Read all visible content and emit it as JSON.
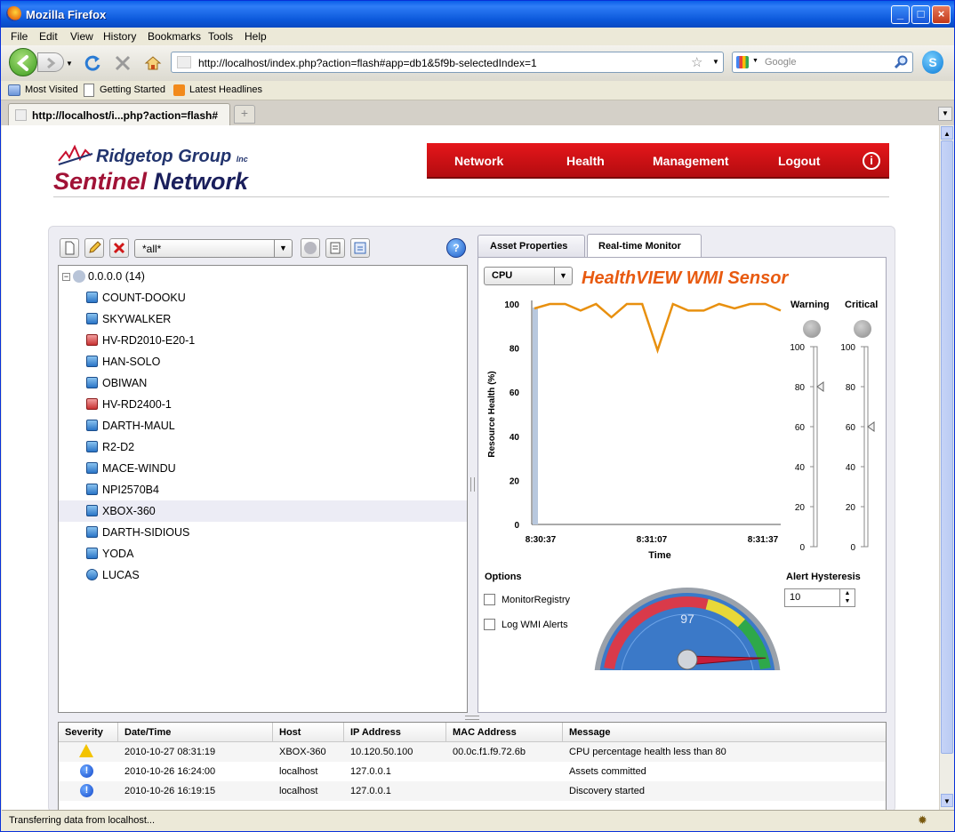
{
  "browser": {
    "title": "Mozilla Firefox",
    "menu": [
      "File",
      "Edit",
      "View",
      "History",
      "Bookmarks",
      "Tools",
      "Help"
    ],
    "url": "http://localhost/index.php?action=flash#app=db1&5f9b-selectedIndex=1",
    "search_placeholder": "Google",
    "bookmarks": [
      "Most Visited",
      "Getting Started",
      "Latest Headlines"
    ],
    "tab_label": "http://localhost/i...php?action=flash#",
    "new_tab_glyph": "+",
    "status": "Transferring data from localhost..."
  },
  "app": {
    "logo_top": "Ridgetop Group",
    "logo_inc": "Inc",
    "logo_sentinel": "Sentinel",
    "logo_network": "Network",
    "nav": [
      "Network",
      "Health",
      "Management",
      "Logout"
    ],
    "info_glyph": "i",
    "help_glyph": "?",
    "filter_value": "*all*",
    "tree_root": "0.0.0.0 (14)",
    "hosts": [
      "COUNT-DOOKU",
      "SKYWALKER",
      "HV-RD2010-E20-1",
      "HAN-SOLO",
      "OBIWAN",
      "HV-RD2400-1",
      "DARTH-MAUL",
      "R2-D2",
      "MACE-WINDU",
      "NPI2570B4",
      "XBOX-360",
      "DARTH-SIDIOUS",
      "YODA",
      "LUCAS"
    ],
    "selected_host": "XBOX-360",
    "tabs": [
      "Asset Properties",
      "Real-time Monitor"
    ],
    "active_tab": "Real-time Monitor",
    "resource_select": "CPU",
    "sensor_title": "HealthVIEW WMI Sensor",
    "warning_label": "Warning",
    "critical_label": "Critical",
    "options_label": "Options",
    "options": [
      "MonitorRegistry",
      "Log WMI Alerts"
    ],
    "alert_hysteresis_label": "Alert Hysteresis",
    "alert_hysteresis_value": "10",
    "slider_ticks": [
      "100",
      "80",
      "60",
      "40",
      "20",
      "0"
    ],
    "warning_threshold": 80,
    "critical_threshold": 60,
    "gauge_value": "97",
    "log": {
      "columns": [
        "Severity",
        "Date/Time",
        "Host",
        "IP Address",
        "MAC Address",
        "Message"
      ],
      "rows": [
        {
          "severity": "warning",
          "datetime": "2010-10-27 08:31:19",
          "host": "XBOX-360",
          "ip": "10.120.50.100",
          "mac": "00.0c.f1.f9.72.6b",
          "message": "CPU percentage health less than 80"
        },
        {
          "severity": "info",
          "datetime": "2010-10-26 16:24:00",
          "host": "localhost",
          "ip": "127.0.0.1",
          "mac": "",
          "message": "Assets committed"
        },
        {
          "severity": "info",
          "datetime": "2010-10-26 16:19:15",
          "host": "localhost",
          "ip": "127.0.0.1",
          "mac": "",
          "message": "Discovery started"
        }
      ]
    },
    "colors": {
      "accent_red": "#d51218",
      "sensor_orange": "#e85a10",
      "line_orange": "#e8900f"
    }
  },
  "chart_data": {
    "type": "line",
    "ylabel": "Resource Health (%)",
    "xlabel": "Time",
    "ylim": [
      0,
      100
    ],
    "yticks": [
      "100",
      "80",
      "60",
      "40",
      "20",
      "0"
    ],
    "xticks": [
      "8:30:37",
      "8:31:07",
      "8:31:37"
    ],
    "series": [
      {
        "values": [
          98,
          100,
          100,
          97,
          100,
          94,
          100,
          100,
          79,
          100,
          97,
          97,
          100,
          98,
          100,
          100,
          97
        ]
      }
    ]
  }
}
